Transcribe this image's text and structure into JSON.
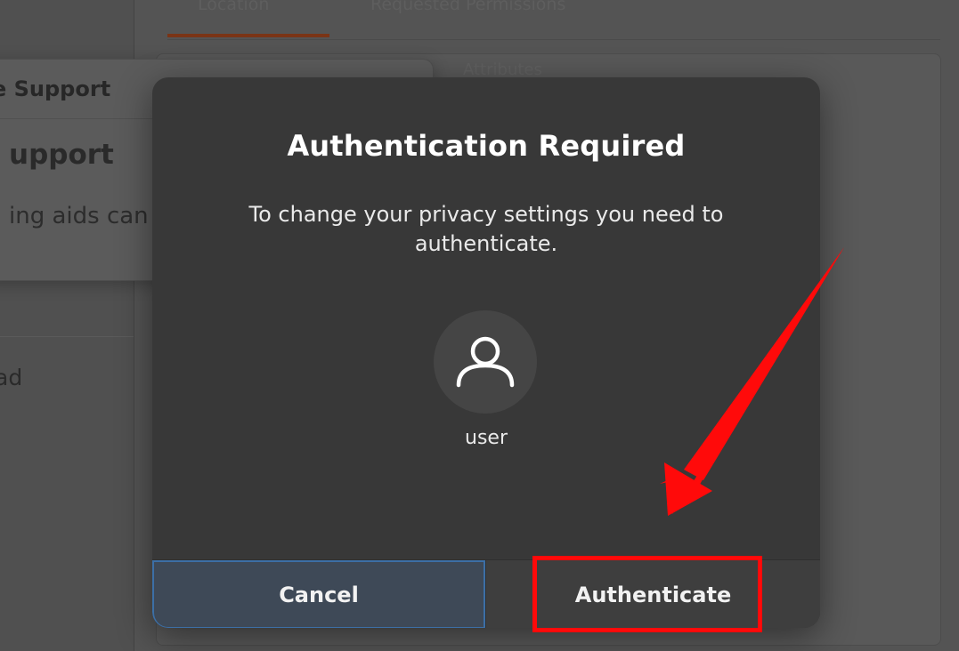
{
  "background": {
    "sidebar_item": "ad",
    "tabs": [
      "Location",
      "Requested Permissions"
    ],
    "ghost_label": "Attributes",
    "popup": {
      "title": "e Support",
      "heading": "upport",
      "text": "ing aids can di"
    }
  },
  "dialog": {
    "title": "Authentication Required",
    "message": "To change your privacy settings you need to authenticate.",
    "username": "user",
    "avatar_icon": "user-avatar-icon",
    "cancel_label": "Cancel",
    "authenticate_label": "Authenticate"
  },
  "annotation": {
    "color": "#ff0a0a",
    "highlight_target": "authenticate-button",
    "arrow_icon": "red-arrow-pointer"
  }
}
